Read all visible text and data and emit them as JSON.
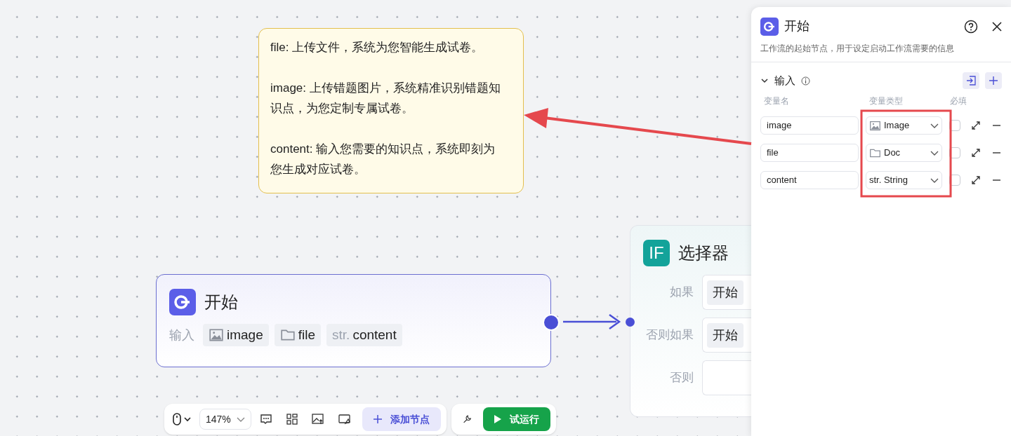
{
  "note": {
    "paragraphs": [
      "file: 上传文件，系统为您智能生成试卷。",
      "image: 上传错题图片，系统精准识别错题知识点，为您定制专属试卷。",
      "content: 输入您需要的知识点，系统即刻为您生成对应试卷。"
    ]
  },
  "start_node": {
    "title": "开始",
    "input_label": "输入",
    "inputs": [
      {
        "kind": "image",
        "name": "image"
      },
      {
        "kind": "file",
        "name": "file"
      },
      {
        "kind": "string",
        "prefix": "str.",
        "name": "content"
      }
    ]
  },
  "if_node": {
    "badge": "IF",
    "title": "选择器",
    "rows": [
      {
        "label": "如果",
        "value": "开始"
      },
      {
        "label": "否则如果",
        "value": "开始"
      },
      {
        "label": "否则"
      }
    ]
  },
  "toolbar": {
    "zoom": "147%",
    "add_node": "添加节点",
    "run": "试运行"
  },
  "panel": {
    "title": "开始",
    "description": "工作流的起始节点，用于设定启动工作流需要的信息",
    "section": {
      "title": "输入",
      "expanded": true
    },
    "columns": [
      "变量名",
      "变量类型",
      "必填"
    ],
    "variables": [
      {
        "name": "image",
        "kind": "image",
        "type_label": "Image",
        "required": false
      },
      {
        "name": "file",
        "kind": "file",
        "type_label": "Doc",
        "required": false
      },
      {
        "name": "content",
        "kind": "string",
        "type_prefix": "str.",
        "type_label": "String",
        "required": false
      }
    ]
  }
}
